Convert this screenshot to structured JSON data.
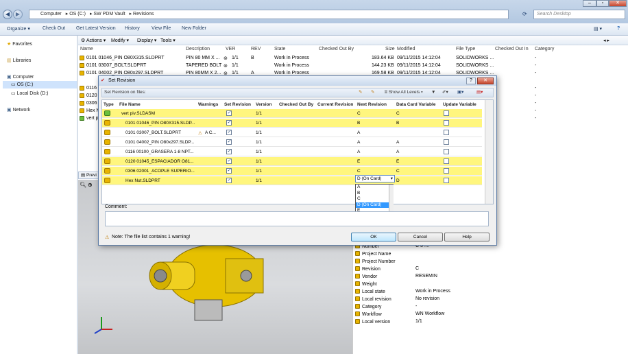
{
  "explorer": {
    "breadcrumb": [
      "Computer",
      "OS (C:)",
      "SW PDM Vault",
      "Revisions"
    ],
    "search_placeholder": "Search Desktop",
    "toolbar": [
      "Organize ▾",
      "Check Out",
      "Get Latest Version",
      "History",
      "View File",
      "New Folder"
    ],
    "nav": {
      "favorites": "Favorites",
      "libraries": "Libraries",
      "computer": "Computer",
      "os": "OS (C:)",
      "local": "Local Disk (D:)",
      "network": "Network"
    },
    "pdm_toolbar": [
      "Actions ▾",
      "Modify ▾",
      "Display ▾",
      "Tools ▾"
    ],
    "columns": [
      "Name",
      "Description",
      "VER",
      "REV",
      "State",
      "Checked Out By",
      "Size",
      "Modified",
      "File Type",
      "Checked Out In",
      "Category"
    ],
    "files": [
      {
        "name": "0101 01046_PIN O80X315.SLDPRT",
        "desc": "PIN 80 MM X ...",
        "ver": "1/1",
        "rev": "B",
        "state": "Work in Process",
        "size": "183.64 KB",
        "mod": "09/11/2015 14:12:04",
        "type": "SOLIDWORKS ...",
        "cat": "-"
      },
      {
        "name": "0101 03007_BOLT.SLDPRT",
        "desc": "TAPERED BOLT",
        "ver": "1/1",
        "rev": "",
        "state": "Work in Process",
        "size": "144.23 KB",
        "mod": "09/11/2015 14:12:04",
        "type": "SOLIDWORKS ...",
        "cat": "-"
      },
      {
        "name": "0101 04002_PIN O80x297.SLDPRT",
        "desc": "PIN 80MM X 2...",
        "ver": "1/1",
        "rev": "A",
        "state": "Work in Process",
        "size": "169.58 KB",
        "mod": "09/11/2015 14:12:04",
        "type": "SOLIDWORKS ...",
        "cat": "-"
      },
      {
        "name": "0116",
        "desc": "",
        "ver": "",
        "rev": "",
        "state": "",
        "size": "",
        "mod": "",
        "type": "",
        "cat": "-"
      },
      {
        "name": "0120",
        "desc": "",
        "ver": "",
        "rev": "",
        "state": "",
        "size": "",
        "mod": "",
        "type": "",
        "cat": "-"
      },
      {
        "name": "0306",
        "desc": "",
        "ver": "",
        "rev": "",
        "state": "",
        "size": "",
        "mod": "",
        "type": "",
        "cat": "-"
      },
      {
        "name": "Hex Nu",
        "desc": "",
        "ver": "",
        "rev": "",
        "state": "",
        "size": "",
        "mod": "",
        "type": "",
        "cat": "-"
      },
      {
        "name": "vert p",
        "desc": "",
        "ver": "",
        "rev": "",
        "state": "",
        "size": "",
        "mod": "",
        "type": "",
        "cat": "-"
      }
    ],
    "preview_tab": "Previ"
  },
  "props": [
    {
      "k": "Number",
      "v": "C 3 ...."
    },
    {
      "k": "Project Name",
      "v": ""
    },
    {
      "k": "Project Number",
      "v": ""
    },
    {
      "k": "Revision",
      "v": "C"
    },
    {
      "k": "Vendor",
      "v": "RESEMIN"
    },
    {
      "k": "Weight",
      "v": ""
    },
    {
      "k": "Local state",
      "v": "Work in Process"
    },
    {
      "k": "Local revision",
      "v": "No revision"
    },
    {
      "k": "Category",
      "v": "-"
    },
    {
      "k": "Workflow",
      "v": "WN Workflow"
    },
    {
      "k": "Local version",
      "v": "1/1"
    }
  ],
  "dialog": {
    "title": "Set Revision",
    "subtitle": "Set Revision on files:",
    "show_levels": "Show All Levels ▾",
    "columns": [
      "Type",
      "File Name",
      "Warnings",
      "Set Revision",
      "Version",
      "Checked Out By",
      "Current Revision",
      "Next Revision",
      "Data Card Variable",
      "Update Variable"
    ],
    "rows": [
      {
        "file": "vert piv.SLDASM",
        "warn": "",
        "ver": "1/1",
        "next": "C",
        "card": "C",
        "hl": true,
        "indent": false
      },
      {
        "file": "0101 01046_PIN O80X315.SLDP...",
        "warn": "",
        "ver": "1/1",
        "next": "B",
        "card": "B",
        "hl": true,
        "indent": true
      },
      {
        "file": "0101 03007_BOLT.SLDPRT",
        "warn": "A C...",
        "ver": "1/1",
        "next": "A",
        "card": "",
        "hl": false,
        "indent": true
      },
      {
        "file": "0101 04002_PIN O80x297.SLDP...",
        "warn": "",
        "ver": "1/1",
        "next": "A",
        "card": "A",
        "hl": false,
        "indent": true
      },
      {
        "file": "0116 00100_GRASERA 1-8 NPT...",
        "warn": "",
        "ver": "1/1",
        "next": "A",
        "card": "A",
        "hl": false,
        "indent": true
      },
      {
        "file": "0120 01045_ESPACIADOR O81...",
        "warn": "",
        "ver": "1/1",
        "next": "E",
        "card": "E",
        "hl": true,
        "indent": true
      },
      {
        "file": "0306 02001_ACOPLE SUPERIO...",
        "warn": "",
        "ver": "1/1",
        "next": "C",
        "card": "C",
        "hl": true,
        "indent": true
      },
      {
        "file": "Hex Nut.SLDPRT",
        "warn": "",
        "ver": "1/1",
        "next": "D (On Card)",
        "card": "D",
        "hl": true,
        "indent": true
      }
    ],
    "dropdown": [
      "A",
      "B",
      "C",
      "D (On Card)",
      "E"
    ],
    "dropdown_selected": "D (On Card)",
    "comment_label": "Comment:",
    "note": "Note: The file list contains 1 warning!",
    "ok": "OK",
    "cancel": "Cancel",
    "help": "Help"
  },
  "colors": {
    "highlight": "#fff67e",
    "accent": "#3399ff"
  }
}
